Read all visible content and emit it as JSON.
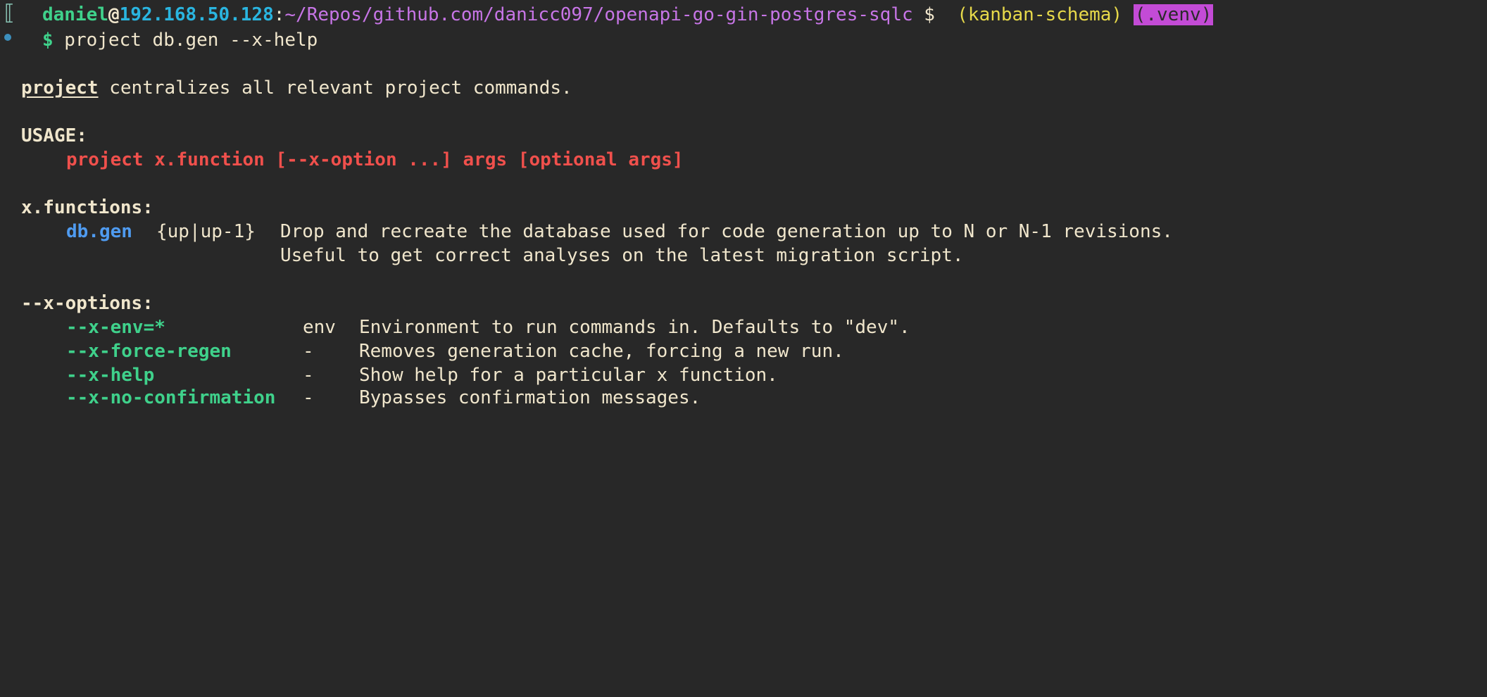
{
  "prompt": {
    "user": "daniel",
    "at": "@",
    "host": "192.168.50.128",
    "colon": ":",
    "path": "~/Repos/github.com/danicc097/openapi-go-gin-postgres-sqlc",
    "dollar": " $ ",
    "branch": " (kanban-schema)",
    "venv": "(.venv)",
    "symbol": "$",
    "command": " project db.gen --x-help"
  },
  "help": {
    "intro_name": "project",
    "intro_rest": " centralizes all relevant project commands.",
    "usage_header": "USAGE:",
    "usage_line": "project x.function [--x-option ...] args [optional args]",
    "functions_header": "x.functions:",
    "functions": [
      {
        "name": "db.gen",
        "args": "{up|up-1}",
        "desc": "Drop and recreate the database used for code generation up to N or N-1 revisions.",
        "desc2": "Useful to get correct analyses on the latest migration script."
      }
    ],
    "options_header": "--x-options:",
    "options": [
      {
        "flag": "--x-env=*",
        "arg": "env",
        "desc": "Environment to run commands in. Defaults to \"dev\"."
      },
      {
        "flag": "--x-force-regen",
        "arg": "-",
        "desc": "Removes generation cache, forcing a new run."
      },
      {
        "flag": "--x-help",
        "arg": "-",
        "desc": "Show help for a particular x function."
      },
      {
        "flag": "--x-no-confirmation",
        "arg": "-",
        "desc": "Bypasses confirmation messages."
      }
    ]
  },
  "colors": {
    "background": "#282828",
    "text": "#f0e6cc",
    "user": "#3fd18b",
    "host": "#2ab5e0",
    "path": "#c775e6",
    "branch": "#e7d94a",
    "venv_bg": "#c34bd6",
    "venv_fg": "#2a2a2a",
    "prompt_symbol": "#3fd18b",
    "usage": "#f0504c",
    "function": "#4f9bf0",
    "option": "#3fd18b"
  }
}
